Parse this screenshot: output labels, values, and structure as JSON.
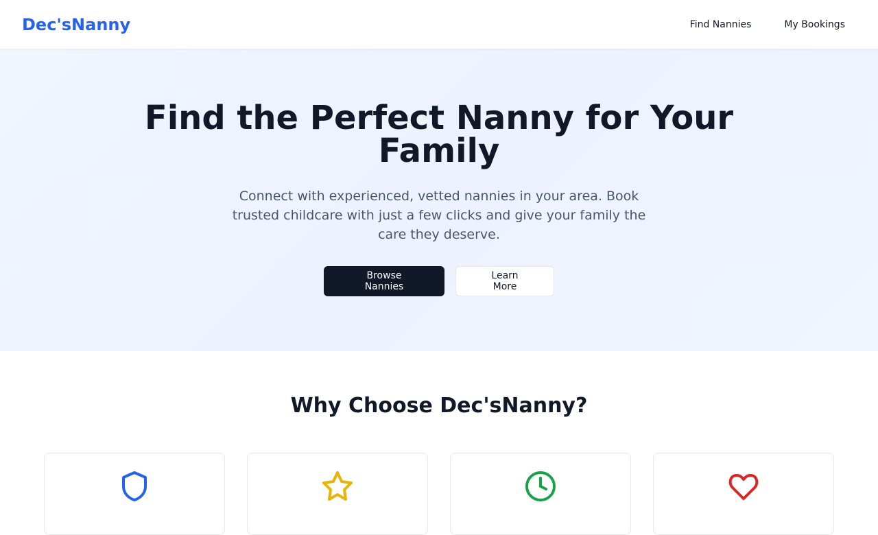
{
  "header": {
    "brand": "Dec'sNanny",
    "nav": [
      {
        "label": "Find Nannies"
      },
      {
        "label": "My Bookings"
      }
    ]
  },
  "hero": {
    "title": "Find the Perfect Nanny for Your Family",
    "subtitle": "Connect with experienced, vetted nannies in your area. Book trusted childcare with just a few clicks and give your family the care they deserve.",
    "primary_button": "Browse Nannies",
    "secondary_button": "Learn More"
  },
  "features": {
    "title": "Why Choose Dec'sNanny?",
    "cards": [
      {
        "icon": "shield-icon",
        "color": "#2563eb"
      },
      {
        "icon": "star-icon",
        "color": "#eab308"
      },
      {
        "icon": "clock-icon",
        "color": "#16a34a"
      },
      {
        "icon": "heart-icon",
        "color": "#dc2626"
      }
    ]
  },
  "colors": {
    "brand": "#2563eb",
    "primary_button_bg": "#111827",
    "hero_bg": "#eff6ff"
  }
}
